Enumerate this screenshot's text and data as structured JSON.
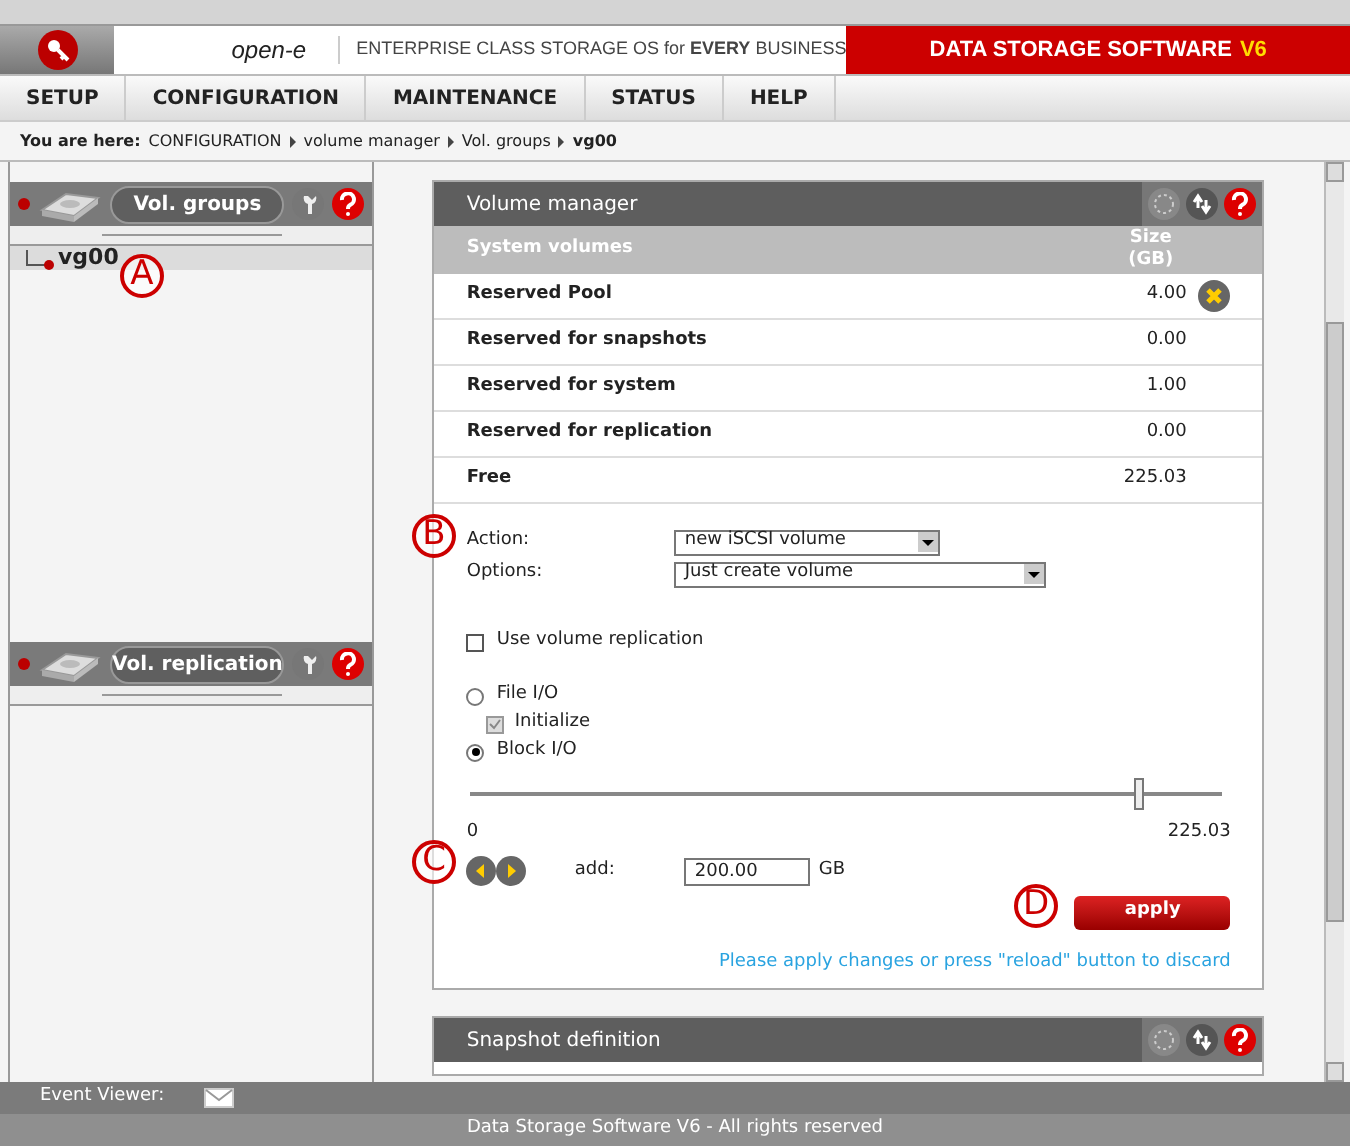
{
  "header": {
    "logo": "open-e",
    "tagline": "ENTERPRISE CLASS STORAGE OS for **EVERY** BUSINESS",
    "product": "DATA STORAGE SOFTWARE",
    "version": "V6"
  },
  "menu": [
    {
      "label": "SETUP"
    },
    {
      "label": "CONFIGURATION"
    },
    {
      "label": "MAINTENANCE"
    },
    {
      "label": "STATUS"
    },
    {
      "label": "HELP"
    }
  ],
  "breadcrumb": {
    "label": "You are here:",
    "items": [
      "CONFIGURATION",
      "volume manager",
      "Vol. groups",
      "vg00"
    ]
  },
  "sidebar": {
    "panels": [
      {
        "title": "Vol. groups",
        "items": [
          {
            "label": "vg00",
            "selected": true
          }
        ]
      },
      {
        "title": "Vol. replication"
      }
    ]
  },
  "volume_manager": {
    "title": "Volume manager",
    "columns": [
      "System volumes",
      "Size (GB)"
    ],
    "rows": [
      {
        "name": "Reserved Pool",
        "size": "4.00",
        "removable": true
      },
      {
        "name": "Reserved for snapshots",
        "size": "0.00",
        "removable": false
      },
      {
        "name": "Reserved for system",
        "size": "1.00",
        "removable": false
      },
      {
        "name": "Reserved for replication",
        "size": "0.00",
        "removable": false
      },
      {
        "name": "Free",
        "size": "225.03",
        "removable": false
      }
    ],
    "action": {
      "label": "Action:",
      "value": "new iSCSI volume"
    },
    "options": {
      "label": "Options:",
      "value": "Just create volume"
    },
    "replication": {
      "label": "Use volume replication",
      "checked": false
    },
    "io": [
      {
        "label": "File I/O",
        "selected": false
      },
      {
        "label": "Block I/O",
        "selected": true
      }
    ],
    "initialize": {
      "label": "Initialize",
      "checked": true,
      "disabled": true
    },
    "slider": {
      "level": 0.89,
      "min": "0",
      "max": "225.03"
    },
    "add": {
      "label": "add:",
      "value": "200.00",
      "unit": "GB"
    },
    "apply": "apply",
    "hint": "Please apply changes or press \"reload\" button to discard"
  },
  "snapshot": {
    "title": "Snapshot definition"
  },
  "event_viewer": {
    "label": "Event Viewer:"
  },
  "footer": "Data Storage Software V6 - All rights reserved",
  "callouts": [
    "A",
    "B",
    "C",
    "D"
  ]
}
